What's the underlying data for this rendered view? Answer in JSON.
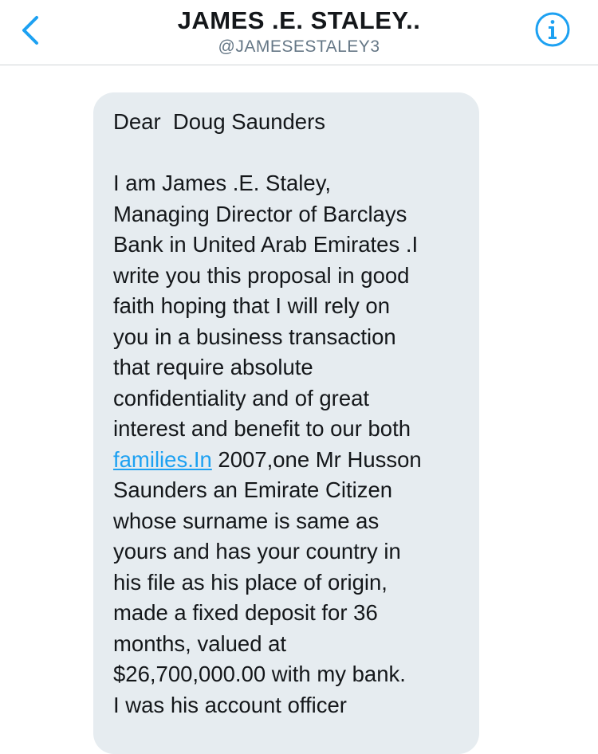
{
  "header": {
    "title": "JAMES .E. STALEY..",
    "handle": "@JAMESESTALEY3",
    "back_icon": "chevron-left-icon",
    "info_icon": "info-icon",
    "accent_color": "#1da1f2"
  },
  "message": {
    "greeting": "Dear  Doug Saunders",
    "body_before_link": "I am James .E. Staley,\nManaging Director of Barclays\nBank in United Arab Emirates .I\nwrite you this proposal in good\nfaith hoping that I will rely on\nyou in a business transaction\nthat require absolute\nconfidentiality and of great\ninterest and benefit to our both\n",
    "link_text": "families.In",
    "body_after_link": " 2007,one Mr Husson\nSaunders an Emirate Citizen\nwhose surname is same as\nyours and has your country in\nhis file as his place of origin,\nmade a fixed deposit for 36\nmonths, valued at\n$26,700,000.00 with my bank.\nI was his account officer",
    "bubble_color": "#e6ecf0"
  }
}
